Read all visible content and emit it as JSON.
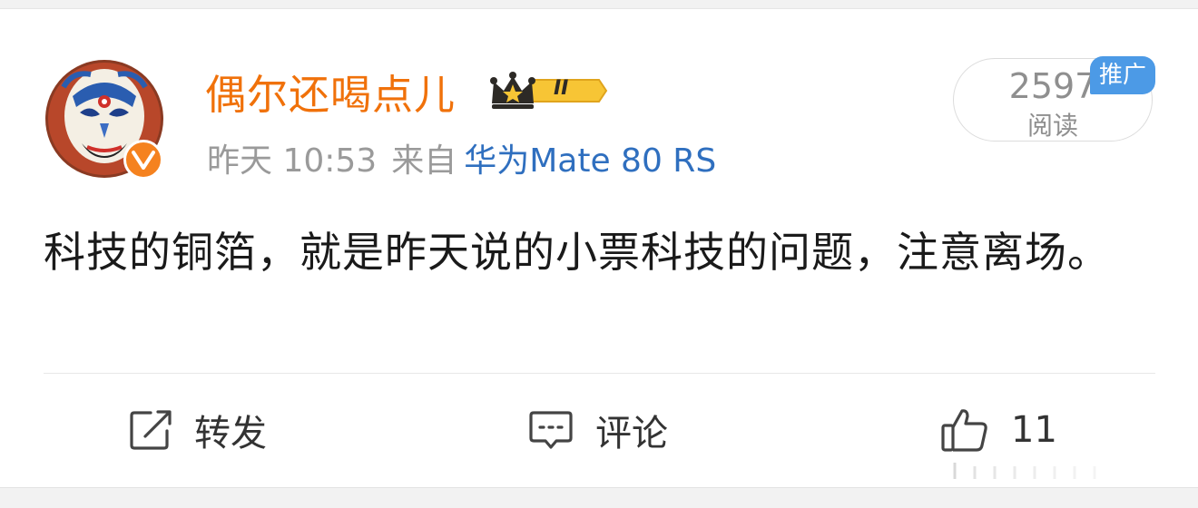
{
  "user": {
    "name": "偶尔还喝点儿",
    "vip_level": "II"
  },
  "meta": {
    "time": "昨天 10:53",
    "from_label": "来自",
    "source": "华为Mate 80 RS"
  },
  "reads": {
    "count": "2597",
    "label": "阅读",
    "promo_tag": "推广"
  },
  "post": {
    "text": "科技的铜箔，就是昨天说的小票科技的问题，注意离场。"
  },
  "actions": {
    "repost_label": "转发",
    "comment_label": "评论",
    "like_count": "11"
  },
  "colors": {
    "username": "#f0710a",
    "source_link": "#2f6fbf",
    "promo": "#4c9ae6",
    "verified": "#f5821f"
  },
  "icons": [
    "avatar-opera-mask",
    "verified-v-icon",
    "crown-icon",
    "repost-icon",
    "comment-icon",
    "like-icon"
  ]
}
